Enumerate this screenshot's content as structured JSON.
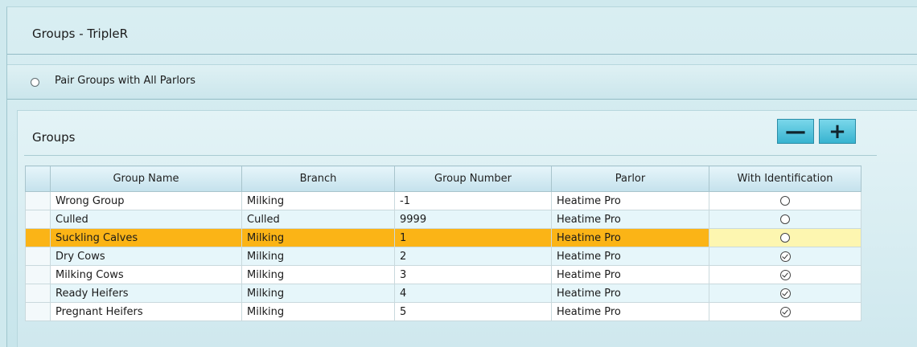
{
  "window": {
    "title": "Groups - TripleR"
  },
  "pair_option": {
    "label": "Pair Groups with All Parlors",
    "selected": false
  },
  "groups": {
    "title": "Groups",
    "remove_icon": "minus-icon",
    "add_icon": "plus-icon",
    "columns": [
      "Group Name",
      "Branch",
      "Group Number",
      "Parlor",
      "With Identification"
    ],
    "rows": [
      {
        "name": "Wrong Group",
        "branch": "Milking",
        "number": "-1",
        "parlor": "Heatime Pro",
        "identification": false
      },
      {
        "name": "Culled",
        "branch": "Culled",
        "number": "9999",
        "parlor": "Heatime Pro",
        "identification": false
      },
      {
        "name": "Suckling Calves",
        "branch": "Milking",
        "number": "1",
        "parlor": "Heatime Pro",
        "identification": false
      },
      {
        "name": "Dry Cows",
        "branch": "Milking",
        "number": "2",
        "parlor": "Heatime Pro",
        "identification": true
      },
      {
        "name": "Milking Cows",
        "branch": "Milking",
        "number": "3",
        "parlor": "Heatime Pro",
        "identification": true
      },
      {
        "name": "Ready Heifers",
        "branch": "Milking",
        "number": "4",
        "parlor": "Heatime Pro",
        "identification": true
      },
      {
        "name": "Pregnant Heifers",
        "branch": "Milking",
        "number": "5",
        "parlor": "Heatime Pro",
        "identification": true
      }
    ],
    "selected_row": 2
  },
  "colors": {
    "selected_row": "#fbb416",
    "selected_cell": "#fdf6b0",
    "button": "#37b3d0"
  }
}
